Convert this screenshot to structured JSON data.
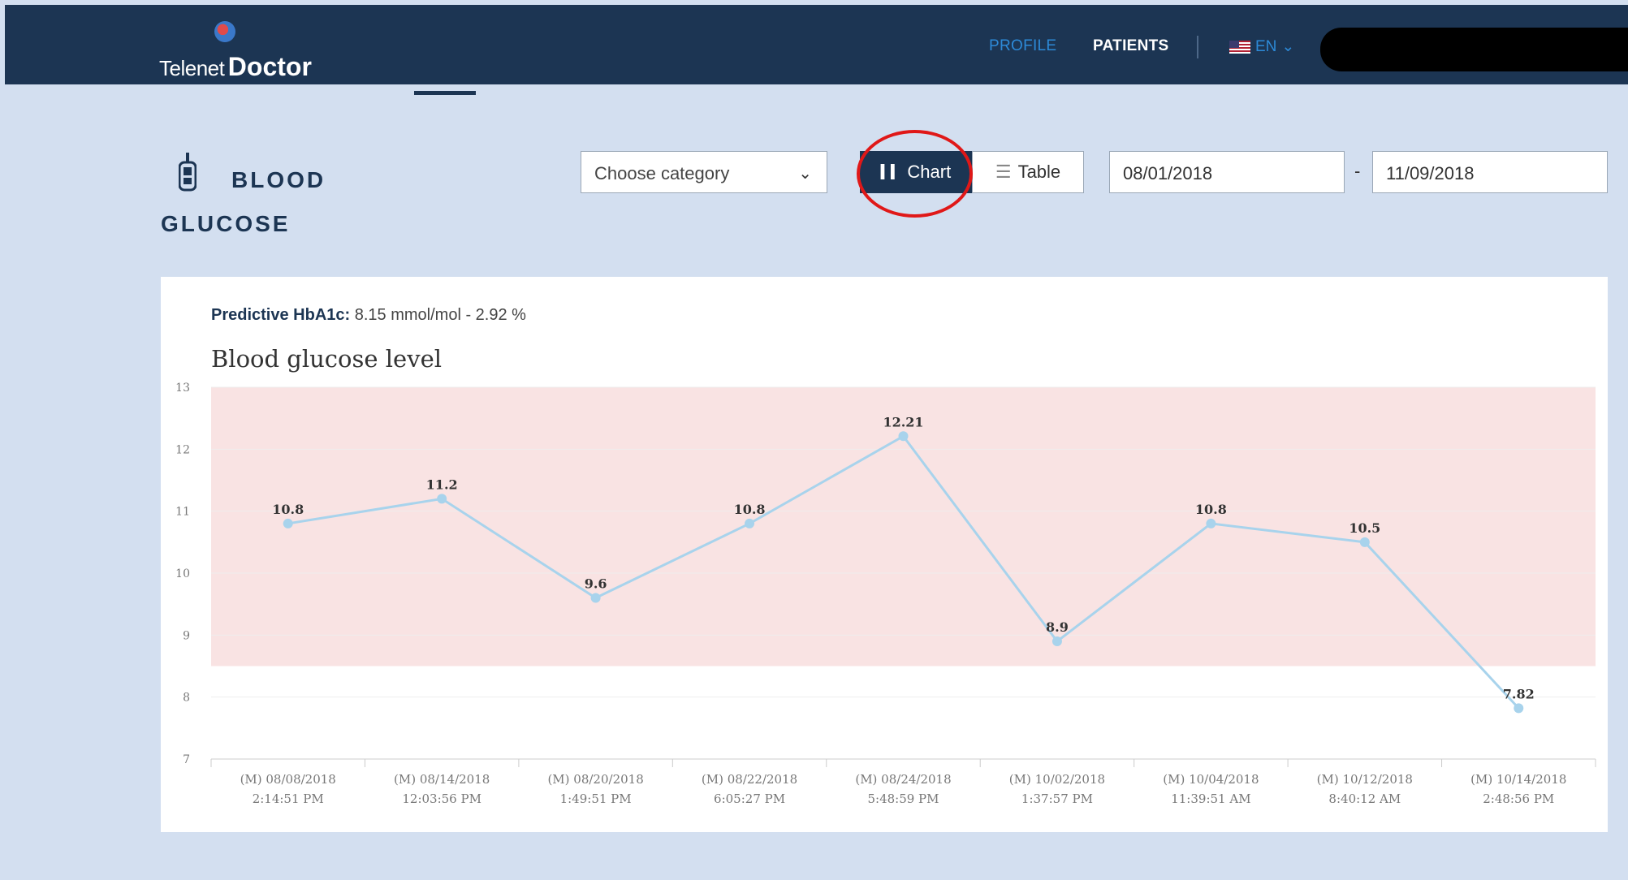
{
  "header": {
    "logo_text_1": "Telenet",
    "logo_text_2": "Doctor",
    "nav": {
      "profile": "PROFILE",
      "patients": "PATIENTS",
      "lang": "EN"
    }
  },
  "page": {
    "title_line1": "BLOOD",
    "title_line2": "GLUCOSE"
  },
  "toolbar": {
    "category_placeholder": "Choose category",
    "chart_label": "Chart",
    "table_label": "Table",
    "date_from": "08/01/2018",
    "date_sep": "-",
    "date_to": "11/09/2018"
  },
  "summary": {
    "hba_label": "Predictive HbA1c:",
    "hba_value": "8.15 mmol/mol - 2.92 %"
  },
  "colors": {
    "header": "#1c3553",
    "line": "#a8d3ec",
    "target_band": "#f9e3e3",
    "highlight": "#e01818"
  },
  "chart_data": {
    "type": "line",
    "title": "Blood glucose level",
    "ylim": [
      7,
      13
    ],
    "yticks": [
      7,
      8,
      9,
      10,
      11,
      12,
      13
    ],
    "target_band": [
      8.5,
      13
    ],
    "categories": [
      [
        "(M) 08/08/2018",
        "2:14:51 PM"
      ],
      [
        "(M) 08/14/2018",
        "12:03:56 PM"
      ],
      [
        "(M) 08/20/2018",
        "1:49:51 PM"
      ],
      [
        "(M) 08/22/2018",
        "6:05:27 PM"
      ],
      [
        "(M) 08/24/2018",
        "5:48:59 PM"
      ],
      [
        "(M) 10/02/2018",
        "1:37:57 PM"
      ],
      [
        "(M) 10/04/2018",
        "11:39:51 AM"
      ],
      [
        "(M) 10/12/2018",
        "8:40:12 AM"
      ],
      [
        "(M) 10/14/2018",
        "2:48:56 PM"
      ]
    ],
    "values": [
      10.8,
      11.2,
      9.6,
      10.8,
      12.21,
      8.9,
      10.8,
      10.5,
      7.82
    ],
    "grid": true,
    "legend": "none"
  }
}
